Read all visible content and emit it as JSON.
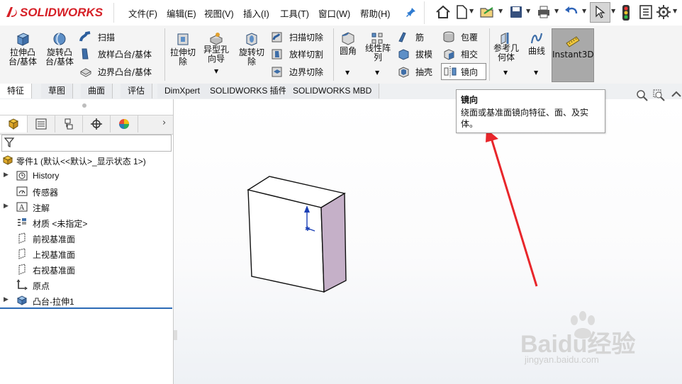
{
  "app": {
    "brand": "SOLIDWORKS"
  },
  "menu": [
    {
      "label": "文件(F)"
    },
    {
      "label": "编辑(E)"
    },
    {
      "label": "视图(V)"
    },
    {
      "label": "插入(I)"
    },
    {
      "label": "工具(T)"
    },
    {
      "label": "窗口(W)"
    },
    {
      "label": "帮助(H)"
    }
  ],
  "commands": {
    "extrude_boss": "拉伸凸台/基体",
    "revolve_boss": "旋转凸台/基体",
    "sweep": "扫描",
    "loft_boss": "放样凸台/基体",
    "boundary_boss": "边界凸台/基体",
    "extrude_cut": "拉伸切除",
    "hole_wizard": "异型孔向导",
    "revolve_cut": "旋转切除",
    "sweep_cut": "扫描切除",
    "loft_cut": "放样切割",
    "boundary_cut": "边界切除",
    "fillet": "圆角",
    "linear_pattern": "线性阵列",
    "rib": "筋",
    "draft": "拔模",
    "shell": "抽壳",
    "wrap": "包覆",
    "intersect": "相交",
    "mirror": "镜向",
    "ref_geometry": "参考几何体",
    "curves": "曲线",
    "instant3d": "Instant3D"
  },
  "tabs": [
    {
      "label": "特征",
      "active": true
    },
    {
      "label": "草图"
    },
    {
      "label": "曲面"
    },
    {
      "label": "评估"
    },
    {
      "label": "DimXpert"
    },
    {
      "label": "SOLIDWORKS 插件"
    },
    {
      "label": "SOLIDWORKS MBD"
    }
  ],
  "tooltip": {
    "title": "镜向",
    "description": "绕面或基准面镜向特征、面、及实体。"
  },
  "tree": {
    "root": "零件1  (默认<<默认>_显示状态 1>)",
    "items": [
      {
        "label": "History",
        "expandable": true
      },
      {
        "label": "传感器",
        "expandable": false
      },
      {
        "label": "注解",
        "expandable": true
      },
      {
        "label": "材质 <未指定>",
        "expandable": false
      },
      {
        "label": "前视基准面",
        "expandable": false
      },
      {
        "label": "上视基准面",
        "expandable": false
      },
      {
        "label": "右视基准面",
        "expandable": false
      },
      {
        "label": "原点",
        "expandable": false
      },
      {
        "label": "凸台-拉伸1",
        "expandable": true
      }
    ]
  },
  "watermark": {
    "brand": "Baidu经验",
    "url": "jingyan.baidu.com"
  },
  "colors": {
    "accent_red": "#d62027",
    "arrow_red": "#e8262b",
    "side_face": "#c5b0c8",
    "selection_blue": "#2c6bb6"
  }
}
